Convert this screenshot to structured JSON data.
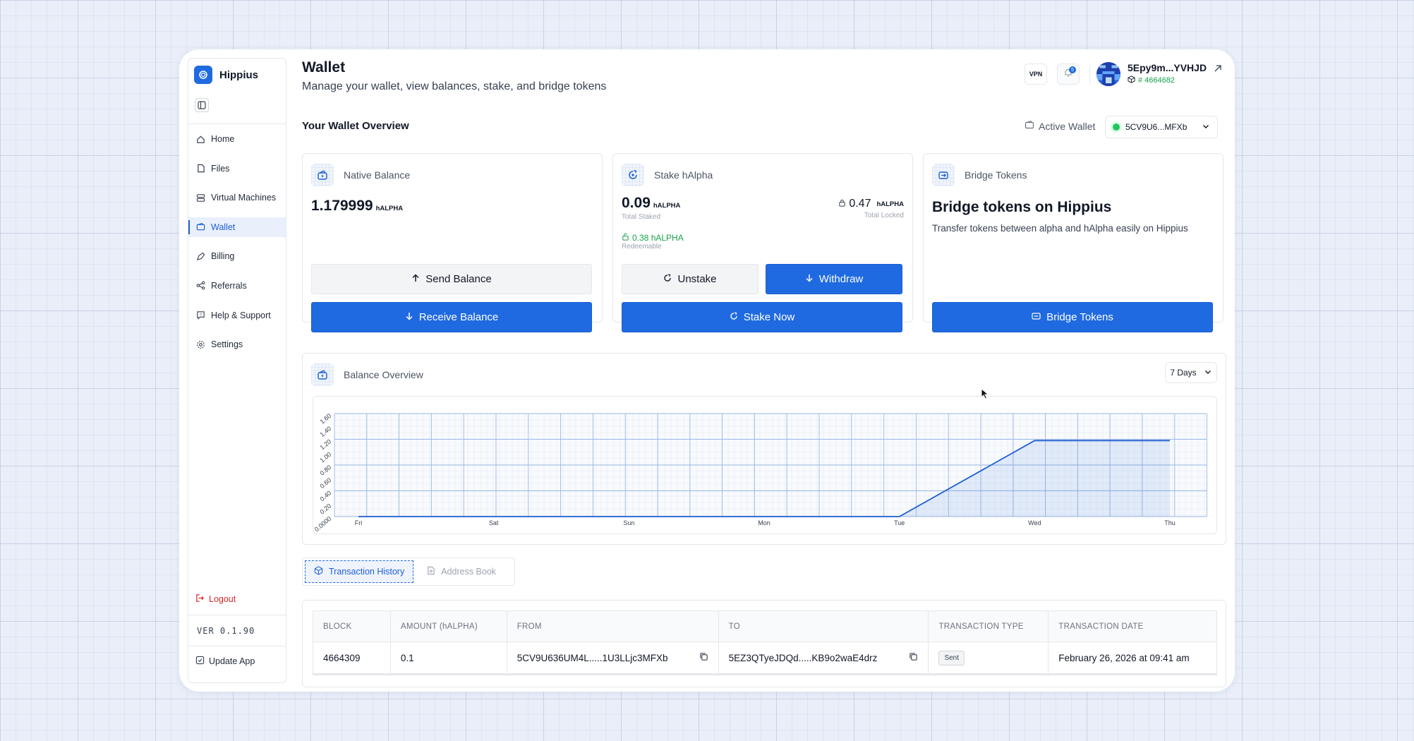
{
  "app": {
    "name": "Hippius"
  },
  "sidebar": {
    "items": [
      {
        "label": "Home",
        "icon": "home-icon",
        "active": false
      },
      {
        "label": "Files",
        "icon": "file-icon",
        "active": false
      },
      {
        "label": "Virtual Machines",
        "icon": "server-icon",
        "active": false
      },
      {
        "label": "Wallet",
        "icon": "wallet-icon",
        "active": true
      },
      {
        "label": "Billing",
        "icon": "billing-icon",
        "active": false
      },
      {
        "label": "Referrals",
        "icon": "share-icon",
        "active": false
      },
      {
        "label": "Help & Support",
        "icon": "help-icon",
        "active": false
      },
      {
        "label": "Settings",
        "icon": "gear-icon",
        "active": false
      }
    ],
    "logout_label": "Logout",
    "version": "VER 0.1.90",
    "update_label": "Update App"
  },
  "header": {
    "title": "Wallet",
    "subtitle": "Manage your wallet, view balances, stake, and bridge tokens",
    "vpn_label": "VPN",
    "notification_count": "5",
    "account_address": "5Epy9m...YVHJD",
    "account_block": "# 4664682"
  },
  "overview": {
    "title": "Your Wallet Overview",
    "active_wallet_label": "Active Wallet",
    "active_wallet_value": "5CV9U6...MFXb"
  },
  "native": {
    "title": "Native Balance",
    "value": "1.179999",
    "unit": "hALPHA",
    "send_label": "Send Balance",
    "receive_label": "Receive Balance"
  },
  "stake": {
    "title": "Stake hAlpha",
    "staked_value": "0.09",
    "staked_unit": "hALPHA",
    "staked_caption": "Total Staked",
    "locked_value": "0.47",
    "locked_unit": "hALPHA",
    "locked_caption": "Total Locked",
    "redeemable_value": "0.38 hALPHA",
    "redeemable_caption": "Redeemable",
    "unstake_label": "Unstake",
    "withdraw_label": "Withdraw",
    "stake_now_label": "Stake Now"
  },
  "bridge": {
    "title": "Bridge Tokens",
    "heading": "Bridge tokens on Hippius",
    "description": "Transfer tokens between alpha and hAlpha easily on Hippius",
    "button_label": "Bridge Tokens"
  },
  "balance_chart": {
    "title": "Balance Overview",
    "range_label": "7 Days"
  },
  "chart_data": {
    "type": "area",
    "x": [
      "Fri",
      "Sat",
      "Sun",
      "Mon",
      "Tue",
      "Wed",
      "Thu"
    ],
    "values": [
      0,
      0,
      0,
      0,
      0,
      1.18,
      1.18
    ],
    "yticks": [
      "0.0000",
      "0.20",
      "0.40",
      "0.60",
      "0.80",
      "1.00",
      "1.20",
      "1.40",
      "1.60"
    ],
    "ylim": [
      0,
      1.6
    ],
    "grid": true,
    "color": "#1f5fd1"
  },
  "tabs": [
    {
      "label": "Transaction History",
      "icon": "cube-icon",
      "active": true
    },
    {
      "label": "Address Book",
      "icon": "book-icon",
      "active": false
    }
  ],
  "transactions": {
    "columns": [
      "BLOCK",
      "AMOUNT (hALPHA)",
      "FROM",
      "TO",
      "TRANSACTION TYPE",
      "TRANSACTION DATE"
    ],
    "rows": [
      {
        "block": "4664309",
        "amount": "0.1",
        "from": "5CV9U636UM4L.....1U3LLjc3MFXb",
        "to": "5EZ3QTyeJDQd.....KB9o2waE4drz",
        "type": "Sent",
        "date": "February 26, 2026 at 09:41 am"
      }
    ]
  },
  "colors": {
    "primary": "#1f6ae0",
    "success": "#16a34a",
    "danger": "#dc2626"
  }
}
